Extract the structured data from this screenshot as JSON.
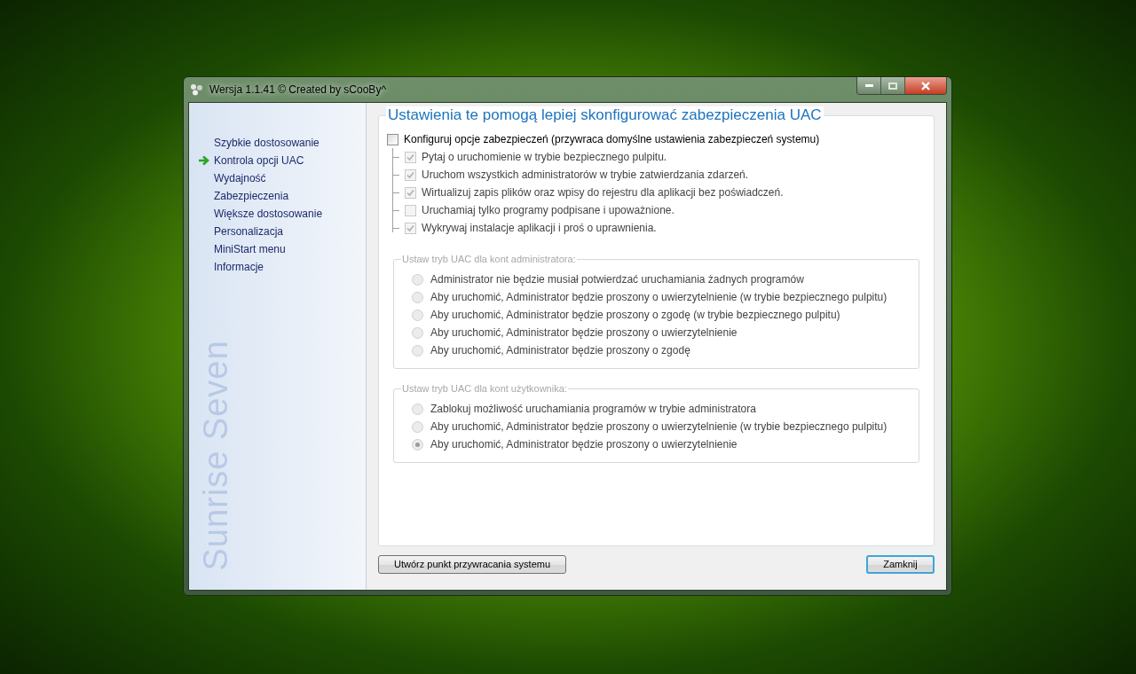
{
  "window": {
    "title": "Wersja 1.1.41 © Created by sCooBy^"
  },
  "sidebar": {
    "items": [
      {
        "label": "Szybkie dostosowanie",
        "selected": false
      },
      {
        "label": "Kontrola opcji UAC",
        "selected": true
      },
      {
        "label": "Wydajność",
        "selected": false
      },
      {
        "label": "Zabezpieczenia",
        "selected": false
      },
      {
        "label": "Większe dostosowanie",
        "selected": false
      },
      {
        "label": "Personalizacja",
        "selected": false
      },
      {
        "label": "MiniStart menu",
        "selected": false
      },
      {
        "label": "Informacje",
        "selected": false
      }
    ],
    "brand": "Sunrise Seven"
  },
  "main": {
    "heading": "Ustawienia te pomogą lepiej skonfigurować zabezpieczenia UAC",
    "master_option": {
      "label": "Konfiguruj opcje zabezpieczeń (przywraca domyślne ustawienia zabezpieczeń systemu)",
      "checked": false
    },
    "sub_options": {
      "disabled": true,
      "items": [
        {
          "label": "Pytaj o uruchomienie w trybie bezpiecznego pulpitu.",
          "checked": true
        },
        {
          "label": "Uruchom wszystkich administratorów w trybie zatwierdzania zdarzeń.",
          "checked": true
        },
        {
          "label": "Wirtualizuj zapis plików oraz wpisy do rejestru dla aplikacji bez poświadczeń.",
          "checked": true
        },
        {
          "label": "Uruchamiaj tylko programy podpisane i upoważnione.",
          "checked": false
        },
        {
          "label": "Wykrywaj instalacje aplikacji i proś o uprawnienia.",
          "checked": true
        }
      ]
    },
    "groups": [
      {
        "legend": "Ustaw tryb UAC dla kont administratora:",
        "disabled": true,
        "options": [
          {
            "label": "Administrator nie będzie musiał potwierdzać uruchamiania żadnych programów",
            "selected": false
          },
          {
            "label": "Aby uruchomić, Administrator będzie proszony o uwierzytelnienie (w trybie bezpiecznego pulpitu)",
            "selected": false
          },
          {
            "label": "Aby uruchomić, Administrator będzie proszony o zgodę (w trybie bezpiecznego pulpitu)",
            "selected": false
          },
          {
            "label": "Aby uruchomić, Administrator będzie proszony o uwierzytelnienie",
            "selected": false
          },
          {
            "label": "Aby uruchomić, Administrator będzie proszony o zgodę",
            "selected": false
          }
        ]
      },
      {
        "legend": "Ustaw tryb UAC dla kont użytkownika:",
        "disabled": true,
        "options": [
          {
            "label": "Zablokuj możliwość uruchamiania programów w trybie administratora",
            "selected": false
          },
          {
            "label": "Aby uruchomić, Administrator będzie proszony o uwierzytelnienie (w trybie bezpiecznego pulpitu)",
            "selected": false
          },
          {
            "label": "Aby uruchomić, Administrator będzie proszony o uwierzytelnienie",
            "selected": true
          }
        ]
      }
    ]
  },
  "buttons": [
    {
      "label": "Utwórz punkt przywracania systemu",
      "focused": false
    },
    {
      "label": "Zamknij",
      "focused": true
    }
  ]
}
